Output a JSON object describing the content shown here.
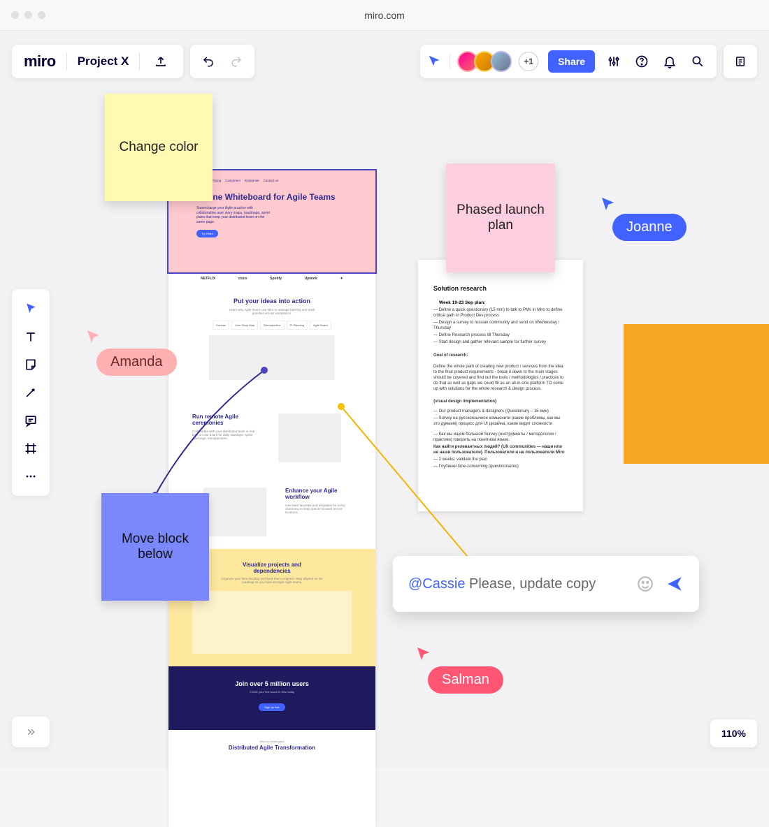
{
  "browser": {
    "url": "miro.com"
  },
  "header": {
    "logo": "miro",
    "project_title": "Project X",
    "plus_count": "+1",
    "share_label": "Share"
  },
  "stickies": {
    "yellow": "Change color",
    "pink": "Phased launch plan",
    "blue": "Move block below"
  },
  "cursors": {
    "amanda": "Amanda",
    "joanne": "Joanne",
    "salman": "Salman"
  },
  "artboard": {
    "hero_title": "Online Whiteboard for Agile Teams",
    "hero_desc": "Supercharge your Agile practice with collaborative user story maps, roadmaps, sprint plans that keep your distributed team on the same page.",
    "hero_cta": "Try it free",
    "brands": [
      "NETFLIX",
      "cisco",
      "Spotify",
      "Upwork"
    ],
    "section2_title": "Put your ideas into action",
    "section2_desc": "Learn why Agile teams use Miro to manage backlog and track priorities across workplaces.",
    "section2_tabs": [
      "Kanban",
      "User Story Map",
      "Retrospective",
      "PI Planning",
      "Agile Board"
    ],
    "section3_title": "Run remote Agile ceremonies",
    "section3_desc": "Collaborate with your distributed team in real time on one board for daily standups, sprint plannings, retrospectives.",
    "section4_title": "Enhance your Agile workflow",
    "section4_desc": "Use team favorites and templates for every ceremony to keep sprints focused across locations.",
    "section5_title": "Visualize projects and dependencies",
    "section5_desc": "Organize your item backlog and track team progress. Stay aligned on the roadmap as you build stronger Agile teams.",
    "dark_title": "Join over 5 million users",
    "dark_sub": "Create your free board in Miro today",
    "dark_cta": "Sign up free",
    "bottom_tag": "Miro for Developers",
    "bottom_title": "Distributed Agile Transformation"
  },
  "doc": {
    "title": "Solution research",
    "plan_head": "Week 19-23 Sep plan:",
    "plan1": "— Define a quick questionary (15 min) to talk to PMs in Miro to define critical path in Product Dev process",
    "plan2": "— Design a survey to russian community and send on Wednesday / Thursday",
    "plan3": "— Define Research process till Thursday",
    "plan4": "— Start design and gather relevant sample for further survey",
    "goal_head": "Goal of research:",
    "goal_body": "Define the whole path of creating new product / services from the idea to the final product requirements - break it down to the main stages should be covered and find out the tools / methodologies / practices to do that as well as gaps we could fill as an all-in-one platform TO come up with solutions for the whole research & design process.",
    "impl_head": "{visual design /implementation}",
    "impl1": "— Our product managers & designers (Questionary – 15 мин)",
    "impl2": "— Survey на русскоязычное комьюнити (какие проблемы, как мы это думаем) процесс для UI дизайна, какие видят сложности",
    "impl3": "— Как мы ищем большой Survey (инструменты / методологии / практики) говорить на понятном языке.",
    "impl4": "Как найти релевантных людей? (UX communities — наши или не наши пользователи). Пользователи и не пользователи Miro",
    "impl5": "— 2 weeks: validate the plan",
    "impl6": "— Глубинки time-consuming (questionnaires)"
  },
  "comment": {
    "mention": "@Cassie",
    "body": " Please, update copy"
  },
  "zoom": "110%"
}
